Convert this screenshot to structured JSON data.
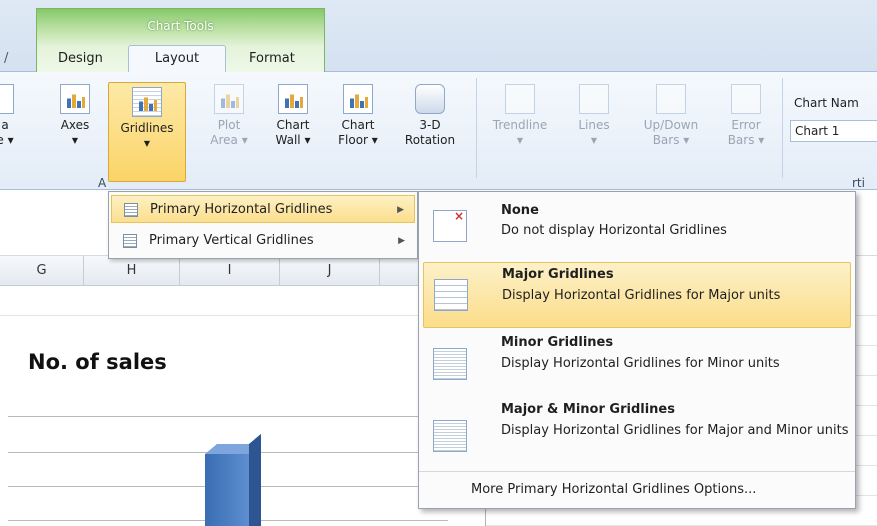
{
  "ribbon": {
    "context_group": "Chart Tools",
    "edge_tab": "/",
    "tabs": {
      "design": "Design",
      "layout": "Layout",
      "format": "Format"
    },
    "left_edge_labels": [
      "a",
      "e ▾"
    ],
    "buttons": {
      "axes": "Axes",
      "gridlines": "Gridlines",
      "plot_area_1": "Plot",
      "plot_area_2": "Area ▾",
      "chart_wall_1": "Chart",
      "chart_wall_2": "Wall ▾",
      "chart_floor_1": "Chart",
      "chart_floor_2": "Floor ▾",
      "rotation_1": "3-D",
      "rotation_2": "Rotation",
      "trendline": "Trendline",
      "lines": "Lines",
      "updown_1": "Up/Down",
      "updown_2": "Bars ▾",
      "error_1": "Error",
      "error_2": "Bars ▾"
    },
    "group_label_axes": "A",
    "group_label_properties": "rti",
    "chart_name_label": "Chart Nam",
    "chart_name_value": "Chart 1"
  },
  "sheet": {
    "columns": [
      "G",
      "H",
      "I",
      "J"
    ]
  },
  "chart": {
    "title": "No. of sales"
  },
  "submenu": {
    "items": [
      {
        "label": "Primary Horizontal Gridlines"
      },
      {
        "label": "Primary Vertical Gridlines"
      }
    ]
  },
  "gallery": {
    "items": [
      {
        "title": "None",
        "desc": "Do not display Horizontal Gridlines"
      },
      {
        "title": "Major Gridlines",
        "desc": "Display Horizontal Gridlines for Major units"
      },
      {
        "title": "Minor Gridlines",
        "desc": "Display Horizontal Gridlines for Minor units"
      },
      {
        "title": "Major & Minor Gridlines",
        "desc": "Display Horizontal Gridlines for Major and Minor units"
      }
    ],
    "footer": "More Primary Horizontal Gridlines Options..."
  },
  "colors": {
    "context_tab_green": "#86c86a",
    "highlight": "#fbd468",
    "bar_blue": "#3a6db2"
  }
}
